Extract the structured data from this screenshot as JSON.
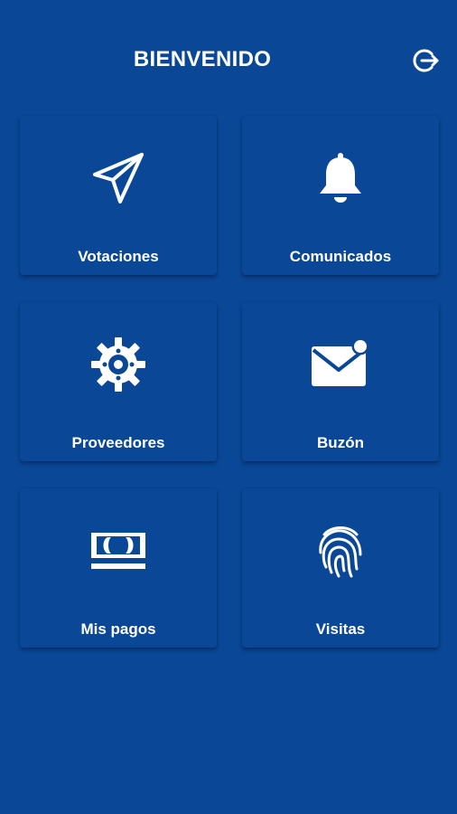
{
  "header": {
    "title": "BIENVENIDO",
    "logout_icon": "logout-icon"
  },
  "menu": {
    "items": [
      {
        "label": "Votaciones",
        "icon": "paper-plane-icon"
      },
      {
        "label": "Comunicados",
        "icon": "bell-icon"
      },
      {
        "label": "Proveedores",
        "icon": "gear-icon"
      },
      {
        "label": "Buzón",
        "icon": "mail-icon"
      },
      {
        "label": "Mis pagos",
        "icon": "money-icon"
      },
      {
        "label": "Visitas",
        "icon": "fingerprint-icon"
      }
    ]
  },
  "colors": {
    "background": "#0a4897",
    "foreground": "#ffffff"
  }
}
